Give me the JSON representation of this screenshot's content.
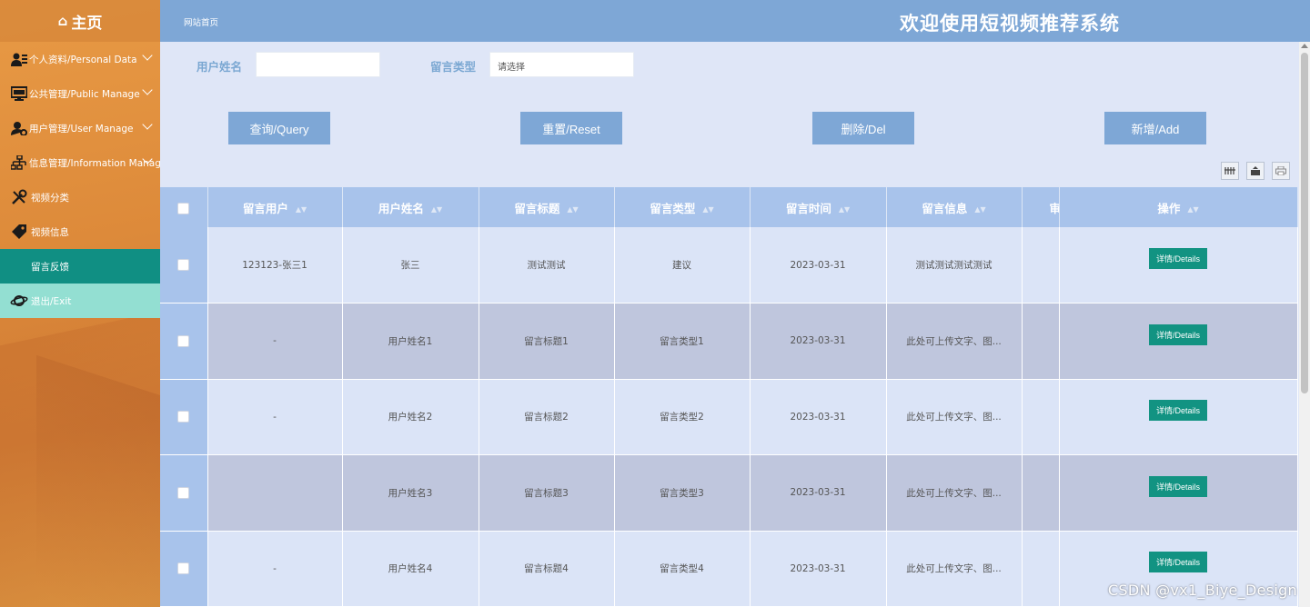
{
  "sidebar": {
    "home_label": "主页",
    "items": [
      {
        "label": "个人资料/Personal Data",
        "icon": "user-card-icon",
        "expandable": true
      },
      {
        "label": "公共管理/Public Manage",
        "icon": "monitor-icon",
        "expandable": true
      },
      {
        "label": "用户管理/User Manage",
        "icon": "user-gear-icon",
        "expandable": true
      },
      {
        "label": "信息管理/Information Manage",
        "icon": "sitemap-icon",
        "expandable": true
      },
      {
        "label": "视频分类",
        "icon": "tools-icon",
        "expandable": false
      },
      {
        "label": "视频信息",
        "icon": "tag-icon",
        "expandable": false
      },
      {
        "label": "留言反馈",
        "icon": "",
        "expandable": false,
        "active": true
      },
      {
        "label": "退出/Exit",
        "icon": "planet-icon",
        "expandable": false
      }
    ]
  },
  "header": {
    "breadcrumb": "网站首页",
    "title": "欢迎使用短视频推荐系统"
  },
  "search": {
    "username_label": "用户姓名",
    "username_value": "",
    "type_label": "留言类型",
    "type_value": "请选择"
  },
  "buttons": {
    "query": "查询/Query",
    "reset": "重置/Reset",
    "delete": "删除/Del",
    "add": "新增/Add"
  },
  "table": {
    "columns": [
      "留言用户",
      "用户姓名",
      "留言标题",
      "留言类型",
      "留言时间",
      "留言信息",
      "审",
      "操作"
    ],
    "detail_label": "详情/Details",
    "rows": [
      {
        "user": "123123-张三1",
        "name": "张三",
        "title": "测试测试",
        "type": "建议",
        "time": "2023-03-31",
        "info": "测试测试测试测试"
      },
      {
        "user": "-",
        "name": "用户姓名1",
        "title": "留言标题1",
        "type": "留言类型1",
        "time": "2023-03-31",
        "info": "此处可上传文字、图..."
      },
      {
        "user": "-",
        "name": "用户姓名2",
        "title": "留言标题2",
        "type": "留言类型2",
        "time": "2023-03-31",
        "info": "此处可上传文字、图..."
      },
      {
        "user": "",
        "name": "用户姓名3",
        "title": "留言标题3",
        "type": "留言类型3",
        "time": "2023-03-31",
        "info": "此处可上传文字、图..."
      },
      {
        "user": "-",
        "name": "用户姓名4",
        "title": "留言标题4",
        "type": "留言类型4",
        "time": "2023-03-31",
        "info": "此处可上传文字、图..."
      }
    ]
  },
  "watermark": "CSDN @vx1_Biye_Design",
  "colors": {
    "header": "#7ea7d6",
    "active_menu": "#108f83",
    "detail_button": "#129382",
    "table_header": "#a8c3eb"
  }
}
